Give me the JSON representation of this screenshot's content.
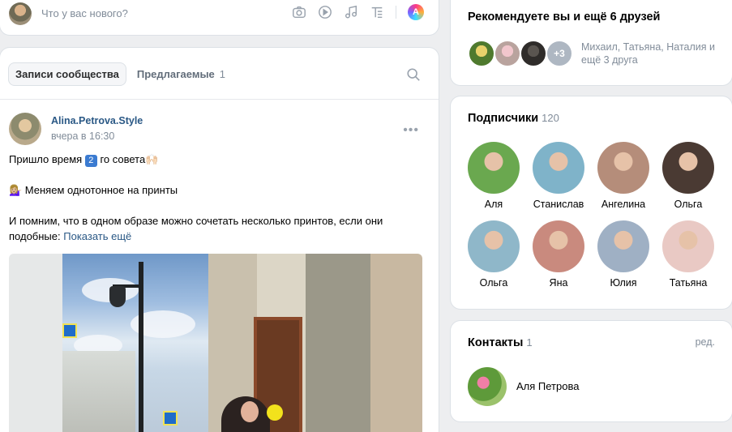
{
  "composer": {
    "placeholder": "Что у вас нового?",
    "ai_label": "A"
  },
  "feed": {
    "tabs": [
      {
        "label": "Записи сообщества",
        "active": true,
        "count": ""
      },
      {
        "label": "Предлагаемые",
        "active": false,
        "count": "1"
      }
    ]
  },
  "post": {
    "author": "Alina.Petrova.Style",
    "time": "вчера в 16:30",
    "line1_before": "Пришло время",
    "line1_badge": "2",
    "line1_after": "го совета🙌🏻",
    "line2": "💁🏼‍♀️ Меняем однотонное на принты",
    "line3": "И помним, что в одном образе можно сочетать несколько принтов, если они подобные:",
    "show_more": "Показать ещё"
  },
  "recommend": {
    "title": "Рекомендуете вы и ещё 6 друзей",
    "more_badge": "+3",
    "friends_text": "Михаил, Татьяна, Наталия и ещё 3 друга"
  },
  "subscribers": {
    "title": "Подписчики",
    "count": "120",
    "people": [
      {
        "name": "Аля",
        "color": "#6aa84f"
      },
      {
        "name": "Станислав",
        "color": "#7fb3c9"
      },
      {
        "name": "Ангелина",
        "color": "#b58d7a"
      },
      {
        "name": "Ольга",
        "color": "#4a3a33"
      },
      {
        "name": "Ольга",
        "color": "#8fb7c9"
      },
      {
        "name": "Яна",
        "color": "#c98a7e"
      },
      {
        "name": "Юлия",
        "color": "#9fb0c4"
      },
      {
        "name": "Татьяна",
        "color": "#e9c9c4"
      }
    ]
  },
  "contacts": {
    "title": "Контакты",
    "count": "1",
    "edit": "ред.",
    "name": "Аля Петрова"
  }
}
